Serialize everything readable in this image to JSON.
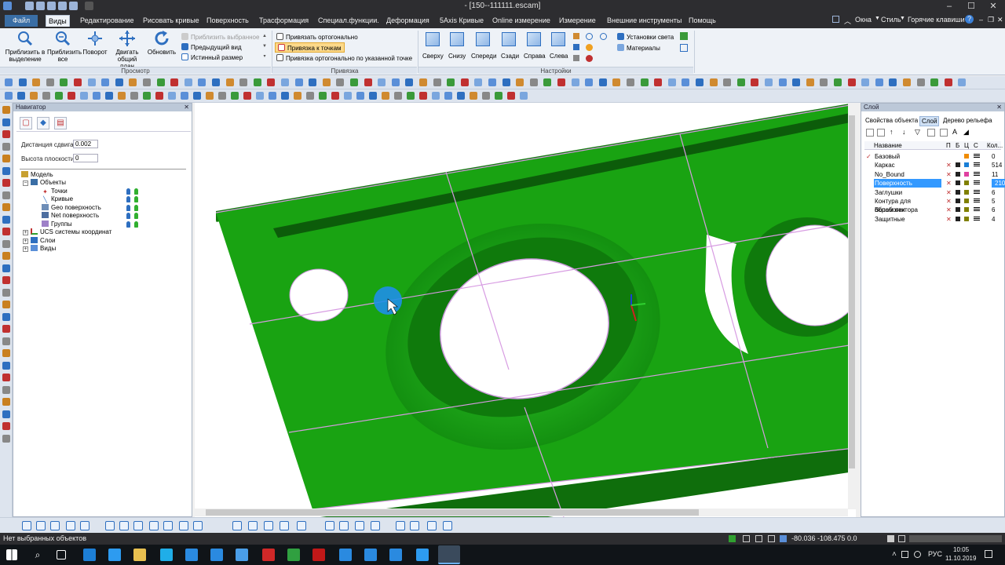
{
  "titlebar": {
    "title": "- [150--111111.escam]"
  },
  "menu": {
    "items": [
      "Файл",
      "Виды",
      "Редактирование",
      "Рисовать кривые",
      "Поверхность",
      "Трасформация",
      "Специал.функции.",
      "Деформация",
      "5Axis Кривые",
      "Online измерение",
      "Измерение",
      "Внешние инструменты",
      "Помощь"
    ],
    "right": [
      "Окна",
      "Стиль",
      "Горячие клавиши"
    ]
  },
  "ribbon": {
    "view_buttons": [
      {
        "label": "Приблизить в выделение"
      },
      {
        "label": "Приблизить все"
      },
      {
        "label": "Поворот"
      },
      {
        "label": "Двигать общий план"
      },
      {
        "label": "Обновить"
      }
    ],
    "view_list": [
      "Приблизить выбранное",
      "Предыдущий вид",
      "Истинный размер"
    ],
    "group_view": "Просмотр",
    "snap_list": [
      "Привязать ортогонально",
      "Привязка к точкам",
      "Привязка ортогонально по указанной точке"
    ],
    "group_snap": "Привязка",
    "ortho_views": [
      "Сверху",
      "Снизу",
      "Спереди",
      "Сзади",
      "Справа",
      "Слева"
    ],
    "light_list": [
      "Установки света",
      "Материалы"
    ],
    "group_settings": "Настройки"
  },
  "navigator": {
    "title": "Навигатор",
    "shift_label": "Дистанция сдвига",
    "shift_value": "0.002",
    "height_label": "Высота плоскости",
    "height_value": "0",
    "tree": [
      {
        "label": "Модель",
        "level": 0
      },
      {
        "label": "Объекты",
        "level": 1
      },
      {
        "label": "Точки",
        "level": 2
      },
      {
        "label": "Кривые",
        "level": 2
      },
      {
        "label": "Geo поверхность",
        "level": 2
      },
      {
        "label": "Net поверхность",
        "level": 2
      },
      {
        "label": "Группы",
        "level": 2
      },
      {
        "label": "UCS системы координат",
        "level": 1
      },
      {
        "label": "Слои",
        "level": 1
      },
      {
        "label": "Виды",
        "level": 1
      }
    ]
  },
  "layers": {
    "title": "Слой",
    "tabs": [
      "Свойства объекта",
      "Слой",
      "Дерево рельефа"
    ],
    "columns": {
      "name": "Название",
      "p": "П",
      "b": "Б",
      "c1": "Ц",
      "c2": "С",
      "count": "Кол..."
    },
    "rows": [
      {
        "name": "Базовый",
        "count": "0",
        "color": "#f08c00"
      },
      {
        "name": "Каркас",
        "count": "514",
        "color": "#1a7fd6"
      },
      {
        "name": "No_Bound",
        "count": "11",
        "color": "#e040a0"
      },
      {
        "name": "Поверхность обработки",
        "count": "210",
        "color": "#808000"
      },
      {
        "name": "Заглушки",
        "count": "6",
        "color": "#808000"
      },
      {
        "name": "Контура для обработки",
        "count": "5",
        "color": "#808000"
      },
      {
        "name": "Вспом вектора",
        "count": "6",
        "color": "#808000"
      },
      {
        "name": "Защитные",
        "count": "4",
        "color": "#808000"
      }
    ],
    "selected_row": 3
  },
  "status": {
    "text": "Нет выбранных объектов",
    "coords": "-80.036 -108.475 0.0"
  },
  "taskbar": {
    "lang": "РУС",
    "time": "10:05",
    "date": "11.10.2019"
  },
  "colors": {
    "model": "#19a312",
    "accent": "#3a6ea5"
  }
}
